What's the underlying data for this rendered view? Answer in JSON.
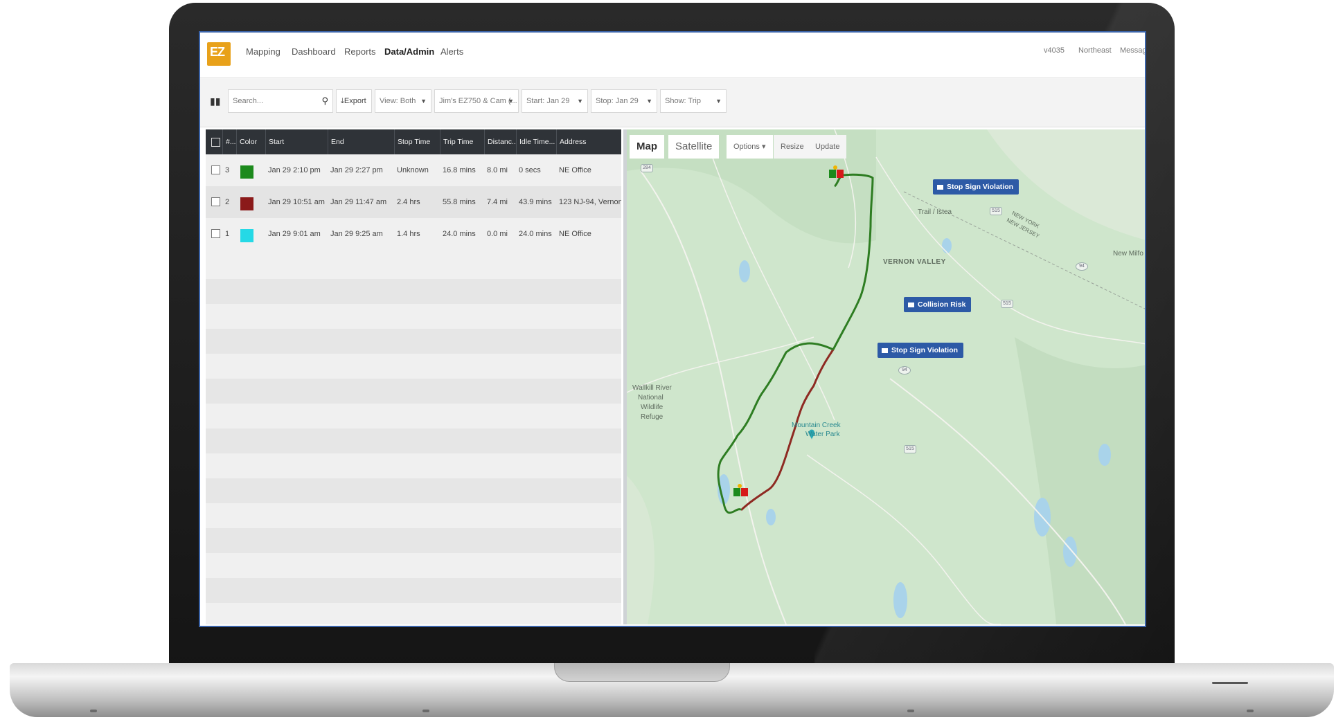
{
  "nav": {
    "logo_text": "EZ",
    "items": [
      "Mapping",
      "Dashboard",
      "Reports",
      "Data/Admin",
      "Alerts"
    ],
    "active": "Data/Admin",
    "version": "v4035",
    "region": "Northeast",
    "messages": "Messag"
  },
  "toolbar": {
    "search_placeholder": "Search...",
    "export_label": "Export",
    "view_label": "View: Both",
    "vehicle_label": "Jim's EZ750 & Cam (...",
    "start_label": "Start: Jan 29",
    "stop_label": "Stop: Jan 29",
    "show_label": "Show: Trip"
  },
  "table": {
    "headers": [
      "#...",
      "Color",
      "Start",
      "End",
      "Stop Time",
      "Trip Time",
      "Distanc...",
      "Idle Time...",
      "Address"
    ],
    "rows": [
      {
        "num": "3",
        "color": "#1c8a1c",
        "start": "Jan 29 2:10 pm",
        "end": "Jan 29 2:27 pm",
        "stop_time": "Unknown",
        "trip_time": "16.8 mins",
        "distance": "8.0 mi",
        "idle": "0 secs",
        "address": "NE Office"
      },
      {
        "num": "2",
        "color": "#8b1a1a",
        "start": "Jan 29 10:51 am",
        "end": "Jan 29 11:47 am",
        "stop_time": "2.4 hrs",
        "trip_time": "55.8 mins",
        "distance": "7.4 mi",
        "idle": "43.9 mins",
        "address": "123 NJ-94, Vernon"
      },
      {
        "num": "1",
        "color": "#25d9e6",
        "start": "Jan 29 9:01 am",
        "end": "Jan 29 9:25 am",
        "stop_time": "1.4 hrs",
        "trip_time": "24.0 mins",
        "distance": "0.0 mi",
        "idle": "24.0 mins",
        "address": "NE Office"
      }
    ]
  },
  "map": {
    "tab_map": "Map",
    "tab_satellite": "Satellite",
    "options": "Options ▾",
    "resize": "Resize",
    "update": "Update",
    "events": [
      "Stop Sign Violation",
      "Collision Risk",
      "Stop Sign Violation"
    ],
    "places": {
      "vernon_valley": "VERNON VALLEY",
      "wallkill": [
        "Wallkill River",
        "National",
        "Wildlife",
        "Refuge"
      ],
      "mountain_creek": [
        "Mountain Creek",
        "Water Park"
      ],
      "trail": "Trail / Istea",
      "new_milford": "New Milfo",
      "state_line": [
        "NEW YORK",
        "NEW JERSEY"
      ]
    },
    "colors": {
      "green_route": "#2e7d22",
      "red_route": "#8e2a22",
      "event_badge": "#2d5aa6"
    }
  }
}
